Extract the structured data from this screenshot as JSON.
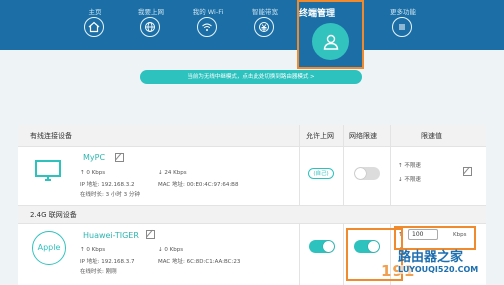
{
  "nav": {
    "items": [
      {
        "label": "主页",
        "icon": "home-icon"
      },
      {
        "label": "我要上网",
        "icon": "globe-icon"
      },
      {
        "label": "我的 Wi-Fi",
        "icon": "wifi-icon"
      },
      {
        "label": "智能带宽",
        "icon": "bandwidth-icon"
      },
      {
        "label": "终端管理",
        "icon": "user-icon",
        "active": true
      },
      {
        "label": "更多功能",
        "icon": "menu-icon"
      }
    ]
  },
  "notice": "当前为无线中继模式，点击此处切换到路由器模式 >",
  "table": {
    "col_wired": "有线连接设备",
    "col_allow": "允许上网",
    "col_limit": "网络限速",
    "col_value": "限速值"
  },
  "wired_device": {
    "name": "MyPC",
    "upload": "0 Kbps",
    "download": "24 Kbps",
    "ip": "IP 地址: 192.168.3.2",
    "mac": "MAC 地址: 00:E0:4C:97:64:B8",
    "online": "在线时长: 3 小时 3 分钟",
    "allow_label": "(自己)",
    "up_limit": "↑ 不限速",
    "down_limit": "↓ 不限速"
  },
  "section_24g": "2.4G 联网设备",
  "wireless_device": {
    "avatar": "Apple",
    "name": "Huawei-TIGER",
    "upload": "0 Kbps",
    "download": "0 Kbps",
    "ip": "IP 地址: 192.168.3.7",
    "mac": "MAC 地址: 6C:8D:C1:AA:BC:23",
    "online": "在线时长: 刚刚",
    "limit_up_value": "100",
    "limit_unit": "Kbps"
  },
  "watermark": {
    "line1": "路由器之家",
    "line2": "LUYOUQI520.COM",
    "digits": "191"
  },
  "colors": {
    "nav_bg": "#1b6fa6",
    "accent": "#2ec2bf",
    "highlight": "#f08a2c"
  }
}
